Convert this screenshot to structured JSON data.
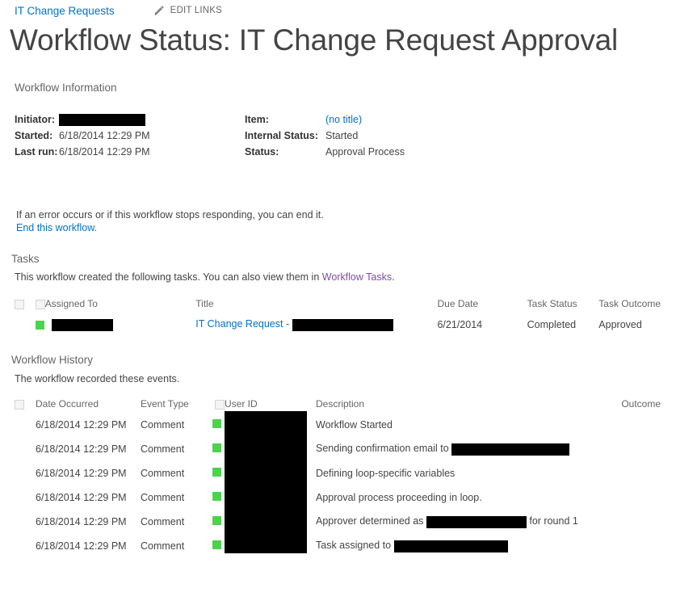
{
  "nav": {
    "breadcrumb": "IT Change Requests",
    "edit_links_label": "EDIT LINKS",
    "pencil_icon": "pencil-icon"
  },
  "page_title": "Workflow Status: IT Change Request Approval",
  "workflow_information": {
    "heading": "Workflow Information",
    "left": [
      {
        "label": "Initiator:",
        "value": "",
        "redacted": true,
        "redact_width": 107
      },
      {
        "label": "Started:",
        "value": "6/18/2014 12:29 PM",
        "redacted": false
      },
      {
        "label": "Last run:",
        "value": "6/18/2014 12:29 PM",
        "redacted": false
      }
    ],
    "right": [
      {
        "label": "Item:",
        "value": "(no title)",
        "is_link": true
      },
      {
        "label": "Internal Status:",
        "value": "Started",
        "is_link": false
      },
      {
        "label": "Status:",
        "value": "Approval Process",
        "is_link": false
      }
    ]
  },
  "end_workflow": {
    "note": "If an error occurs or if this workflow stops responding, you can end it.",
    "link": "End this workflow."
  },
  "tasks": {
    "heading": "Tasks",
    "note_before": "This workflow created the following tasks. You can also view them in ",
    "note_link": "Workflow Tasks",
    "note_after": ".",
    "columns": [
      "",
      "Assigned To",
      "Title",
      "Due Date",
      "Task Status",
      "Task Outcome"
    ],
    "rows": [
      {
        "assigned_to": "",
        "assigned_to_redact_width": 76,
        "title_prefix": "IT Change Request - ",
        "title_redact_width": 125,
        "due_date": "6/21/2014",
        "task_status": "Completed",
        "task_outcome": "Approved"
      }
    ]
  },
  "workflow_history": {
    "heading": "Workflow History",
    "note": "The workflow recorded these events.",
    "columns": [
      "",
      "Date Occurred",
      "Event Type",
      "User ID",
      "Description",
      "Outcome"
    ],
    "rows": [
      {
        "date_occurred": "6/18/2014 12:29 PM",
        "event_type": "Comment",
        "user_id": "",
        "description_prefix": "Workflow Started",
        "description_redact_width": 0,
        "description_suffix": "",
        "outcome": ""
      },
      {
        "date_occurred": "6/18/2014 12:29 PM",
        "event_type": "Comment",
        "user_id": "",
        "description_prefix": "Sending confirmation email to ",
        "description_redact_width": 146,
        "description_suffix": "",
        "outcome": ""
      },
      {
        "date_occurred": "6/18/2014 12:29 PM",
        "event_type": "Comment",
        "user_id": "",
        "description_prefix": "Defining loop-specific variables",
        "description_redact_width": 0,
        "description_suffix": "",
        "outcome": ""
      },
      {
        "date_occurred": "6/18/2014 12:29 PM",
        "event_type": "Comment",
        "user_id": "",
        "description_prefix": "Approval process proceeding in loop.",
        "description_redact_width": 0,
        "description_suffix": "",
        "outcome": ""
      },
      {
        "date_occurred": "6/18/2014 12:29 PM",
        "event_type": "Comment",
        "user_id": "",
        "description_prefix": "Approver determined as ",
        "description_redact_width": 124,
        "description_suffix": " for round 1",
        "outcome": ""
      },
      {
        "date_occurred": "6/18/2014 12:29 PM",
        "event_type": "Comment",
        "user_id": "",
        "description_prefix": "Task assigned to ",
        "description_redact_width": 141,
        "description_suffix": "",
        "outcome": ""
      }
    ]
  },
  "colors": {
    "link": "#0072c6",
    "visited_link": "#7b4fa0",
    "status_green": "#4cd24c",
    "text": "#444444",
    "muted": "#666666",
    "redaction": "#000000"
  }
}
